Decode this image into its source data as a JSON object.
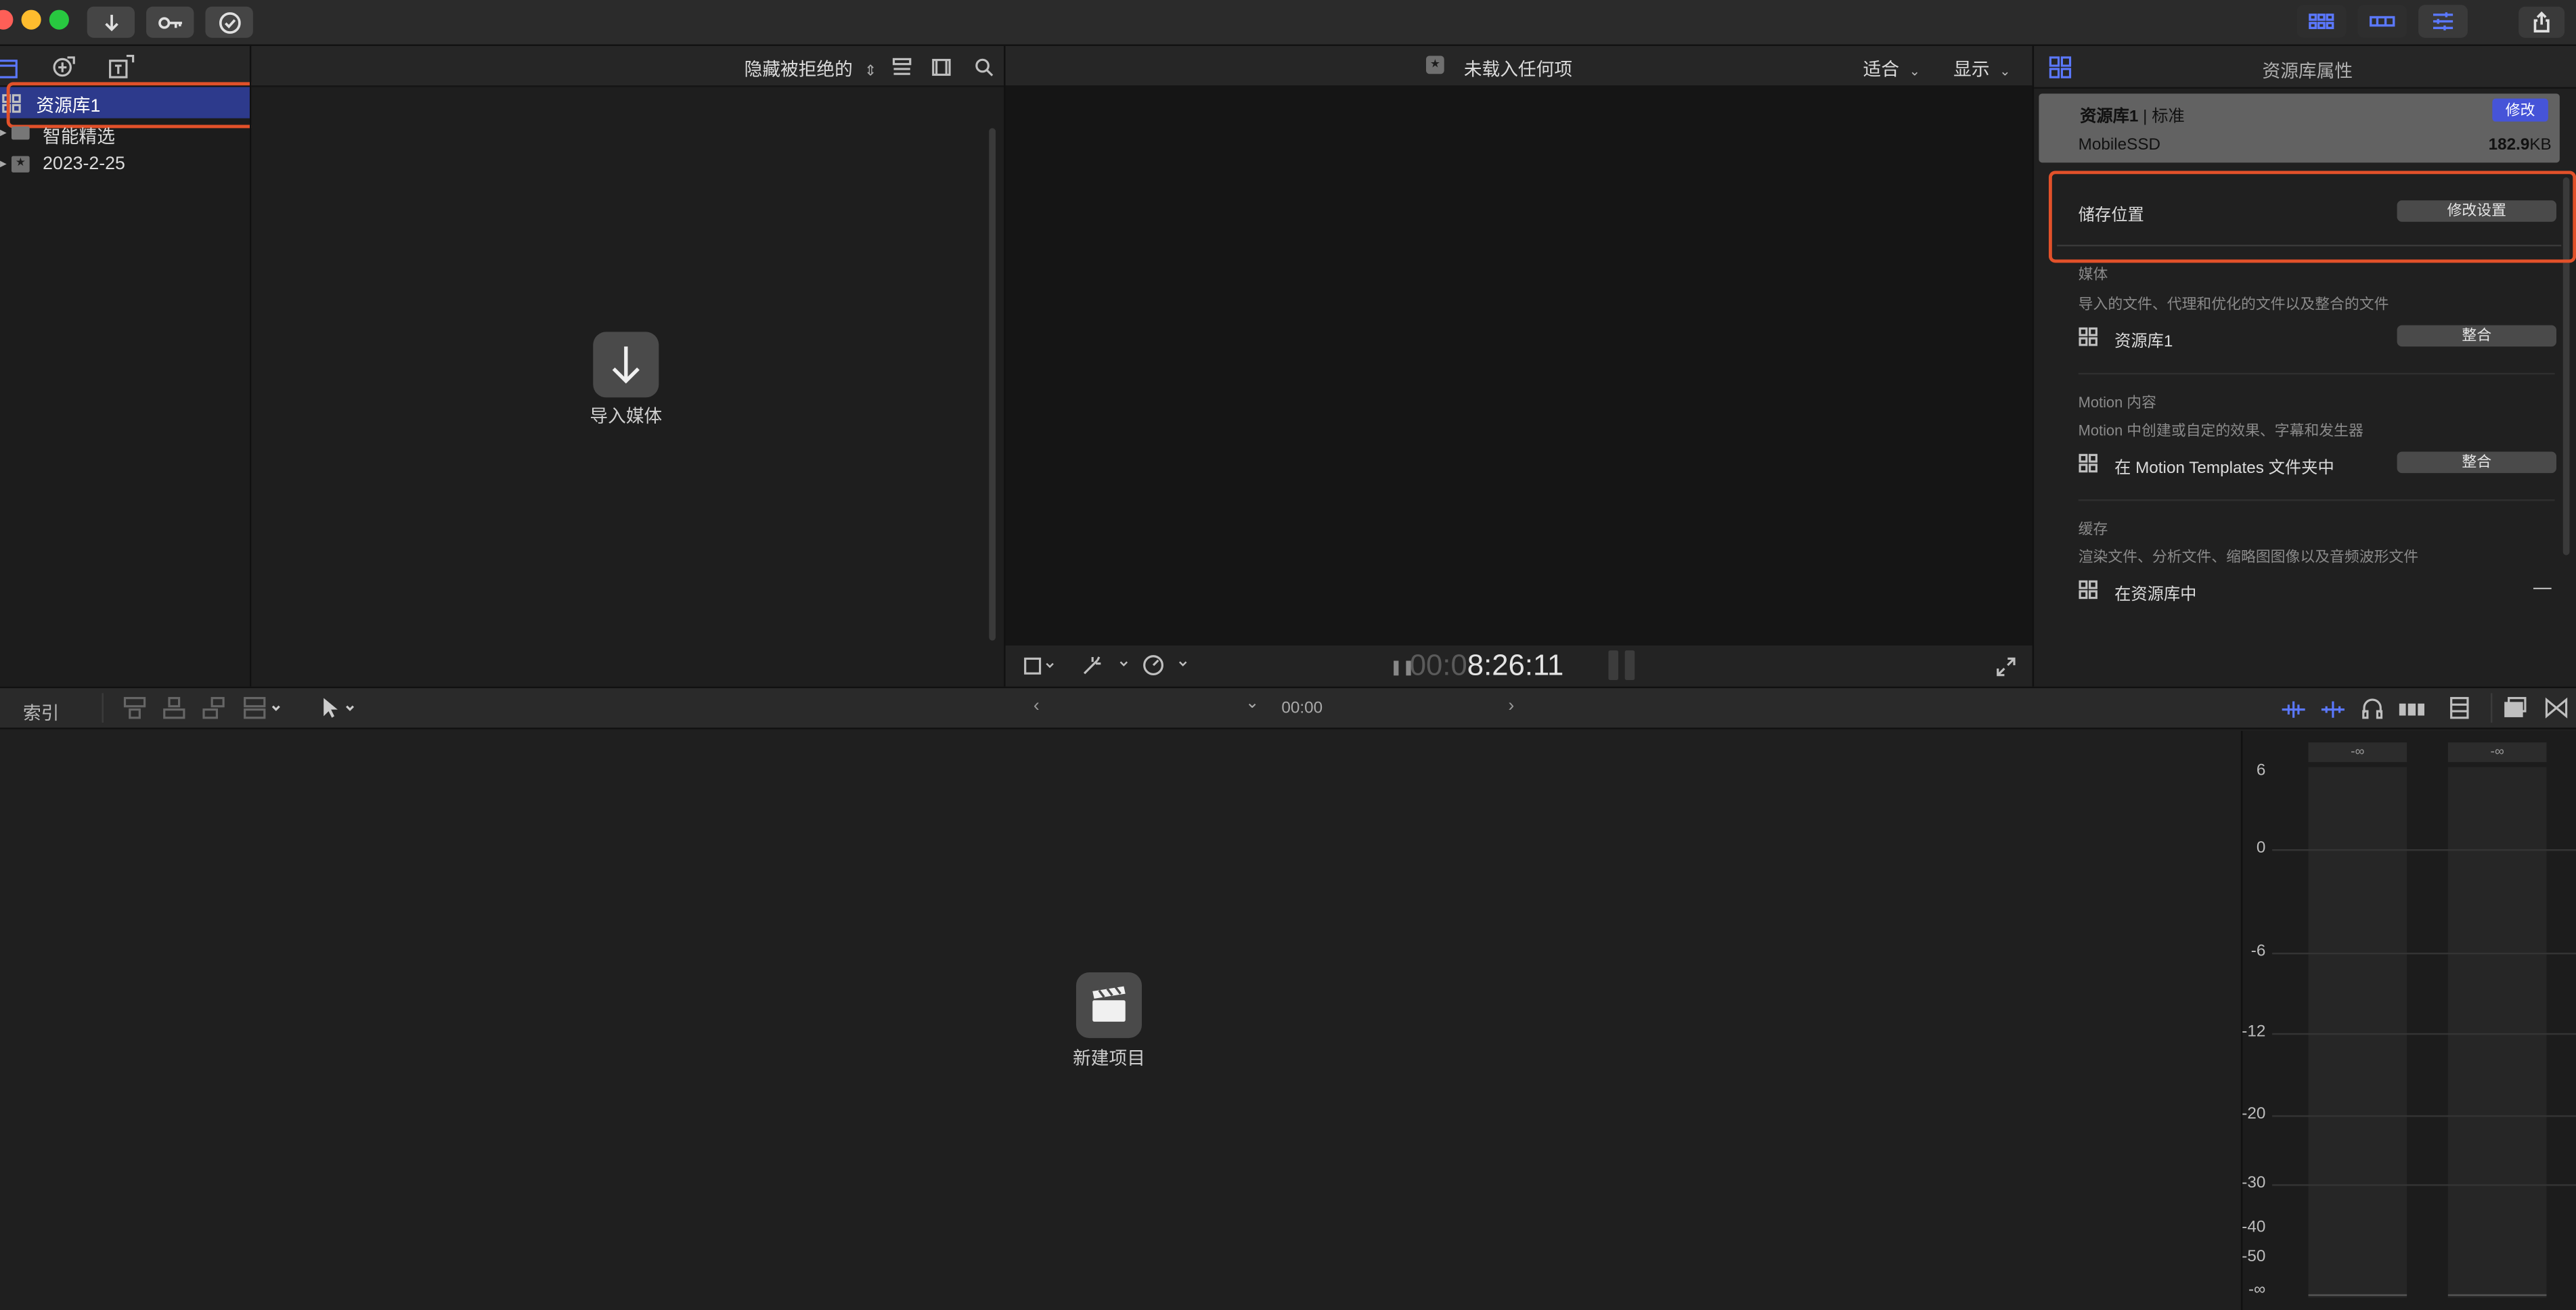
{
  "library_sidebar": {
    "items": [
      {
        "label": "资源库1",
        "selected": true
      },
      {
        "label": "智能精选"
      },
      {
        "label": "2023-2-25"
      }
    ]
  },
  "browser": {
    "filter_label": "隐藏被拒绝的",
    "import_label": "导入媒体"
  },
  "viewer": {
    "title": "未载入任何项",
    "fit_label": "适合",
    "display_label": "显示",
    "timecode_dim": "00:0",
    "timecode_main": "8:26:11"
  },
  "inspector": {
    "title": "资源库属性",
    "library_name": "资源库1",
    "library_mode": "| 标准",
    "modify_label": "修改",
    "disk_name": "MobileSSD",
    "size_number": "182.9",
    "size_unit": "KB",
    "storage_label": "储存位置",
    "modify_settings_label": "修改设置",
    "media": {
      "heading": "媒体",
      "desc": "导入的文件、代理和优化的文件以及整合的文件",
      "location": "资源库1",
      "button": "整合"
    },
    "motion": {
      "heading": "Motion 内容",
      "desc": "Motion 中创建或自定的效果、字幕和发生器",
      "location": "在 Motion Templates 文件夹中",
      "button": "整合"
    },
    "cache": {
      "heading": "缓存",
      "desc": "渲染文件、分析文件、缩略图图像以及音频波形文件",
      "location": "在资源库中",
      "dash": "—"
    }
  },
  "timeline": {
    "index_label": "索引",
    "timecode": "00:00",
    "new_project_label": "新建项目"
  },
  "meters": {
    "peak_left": "-∞",
    "peak_right": "-∞",
    "scale": [
      "6",
      "0",
      "-6",
      "-12",
      "-20",
      "-30",
      "-40",
      "-50",
      "-∞"
    ]
  },
  "colors": {
    "accent": "#5b78ff",
    "selection": "#2d3a8c",
    "highlight_box": "#e2512a"
  }
}
